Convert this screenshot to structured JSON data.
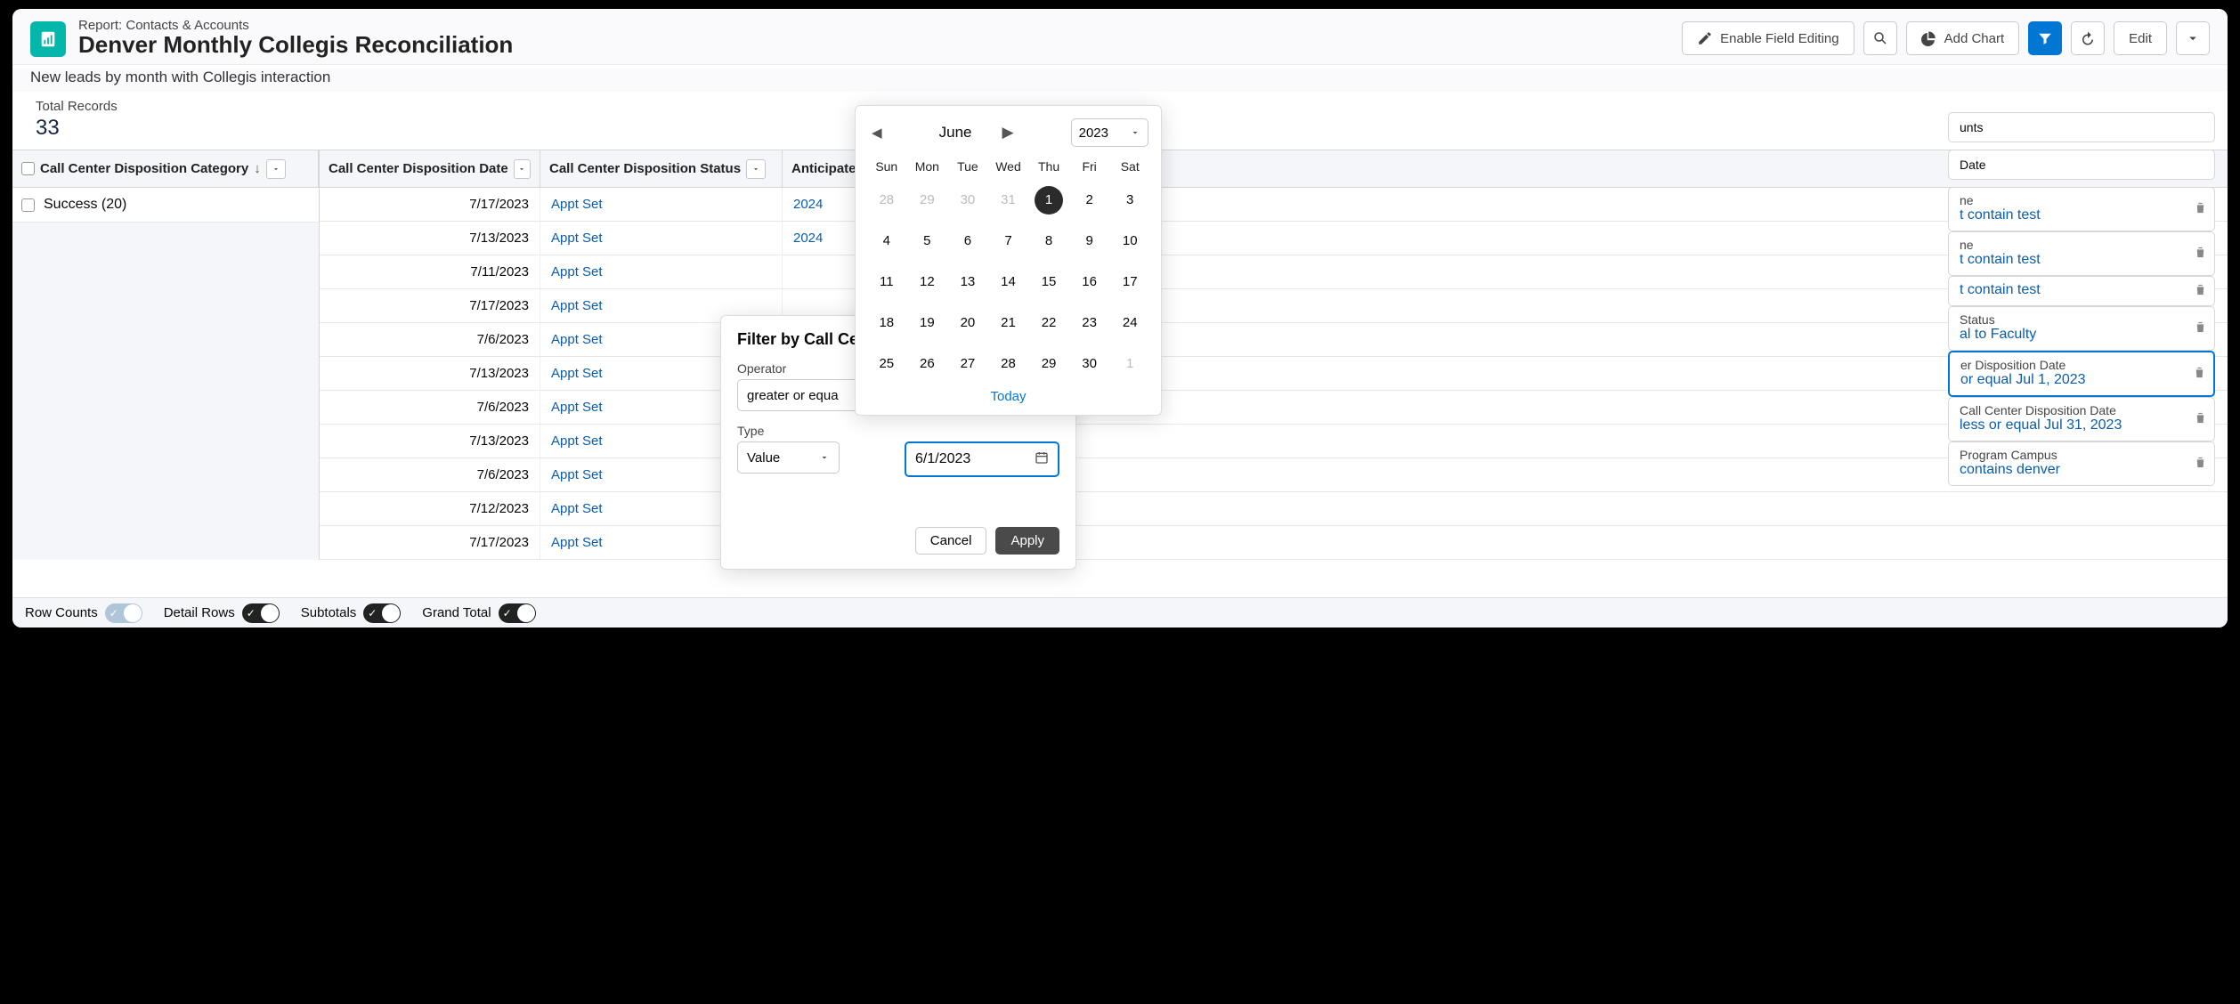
{
  "header": {
    "eyebrow": "Report: Contacts & Accounts",
    "title": "Denver Monthly Collegis Reconciliation",
    "subtitle": "New leads by month with Collegis interaction",
    "editFieldLabel": "Enable Field Editing",
    "addChartLabel": "Add Chart",
    "editLabel": "Edit"
  },
  "summary": {
    "label": "Total Records",
    "value": "33"
  },
  "columns": {
    "group": "Call Center Disposition Category",
    "c1": "Call Center Disposition Date",
    "c2": "Call Center Disposition Status",
    "c3": "Anticipate"
  },
  "group": {
    "label": "Success (20)"
  },
  "rows": [
    {
      "date": "7/17/2023",
      "status": "Appt Set",
      "year": "2024"
    },
    {
      "date": "7/13/2023",
      "status": "Appt Set",
      "year": "2024"
    },
    {
      "date": "7/11/2023",
      "status": "Appt Set",
      "year": ""
    },
    {
      "date": "7/17/2023",
      "status": "Appt Set",
      "year": ""
    },
    {
      "date": "7/6/2023",
      "status": "Appt Set",
      "year": ""
    },
    {
      "date": "7/13/2023",
      "status": "Appt Set",
      "year": ""
    },
    {
      "date": "7/6/2023",
      "status": "Appt Set",
      "year": ""
    },
    {
      "date": "7/13/2023",
      "status": "Appt Set",
      "year": ""
    },
    {
      "date": "7/6/2023",
      "status": "Appt Set",
      "year": ""
    },
    {
      "date": "7/12/2023",
      "status": "Appt Set",
      "year": ""
    },
    {
      "date": "7/17/2023",
      "status": "Appt Set",
      "year": ""
    }
  ],
  "filtersTop": {
    "label": "unts"
  },
  "filterDate": {
    "label": "Date"
  },
  "filters": [
    {
      "label": "ne",
      "value": "t contain test"
    },
    {
      "label": "ne",
      "value": "t contain test"
    },
    {
      "label": "",
      "value": "t contain test"
    },
    {
      "label": "Status",
      "value": "al to Faculty"
    },
    {
      "label": "er Disposition Date",
      "value": "or equal Jul 1, 2023",
      "active": true
    },
    {
      "label": "Call Center Disposition Date",
      "value": "less or equal Jul 31, 2023"
    },
    {
      "label": "Program Campus",
      "value": "contains denver"
    }
  ],
  "filterEditor": {
    "title": "Filter by Call Cen",
    "operatorLabel": "Operator",
    "operatorValue": "greater or equa",
    "typeLabel": "Type",
    "typeValue": "Value",
    "dateValue": "6/1/2023",
    "cancel": "Cancel",
    "apply": "Apply"
  },
  "datepicker": {
    "month": "June",
    "year": "2023",
    "dows": [
      "Sun",
      "Mon",
      "Tue",
      "Wed",
      "Thu",
      "Fri",
      "Sat"
    ],
    "lead": [
      28,
      29,
      30,
      31
    ],
    "days": [
      1,
      2,
      3,
      4,
      5,
      6,
      7,
      8,
      9,
      10,
      11,
      12,
      13,
      14,
      15,
      16,
      17,
      18,
      19,
      20,
      21,
      22,
      23,
      24,
      25,
      26,
      27,
      28,
      29,
      30
    ],
    "trail": [
      1
    ],
    "selected": 1,
    "today": "Today"
  },
  "footer": {
    "rowCounts": "Row Counts",
    "detailRows": "Detail Rows",
    "subtotals": "Subtotals",
    "grandTotal": "Grand Total"
  }
}
